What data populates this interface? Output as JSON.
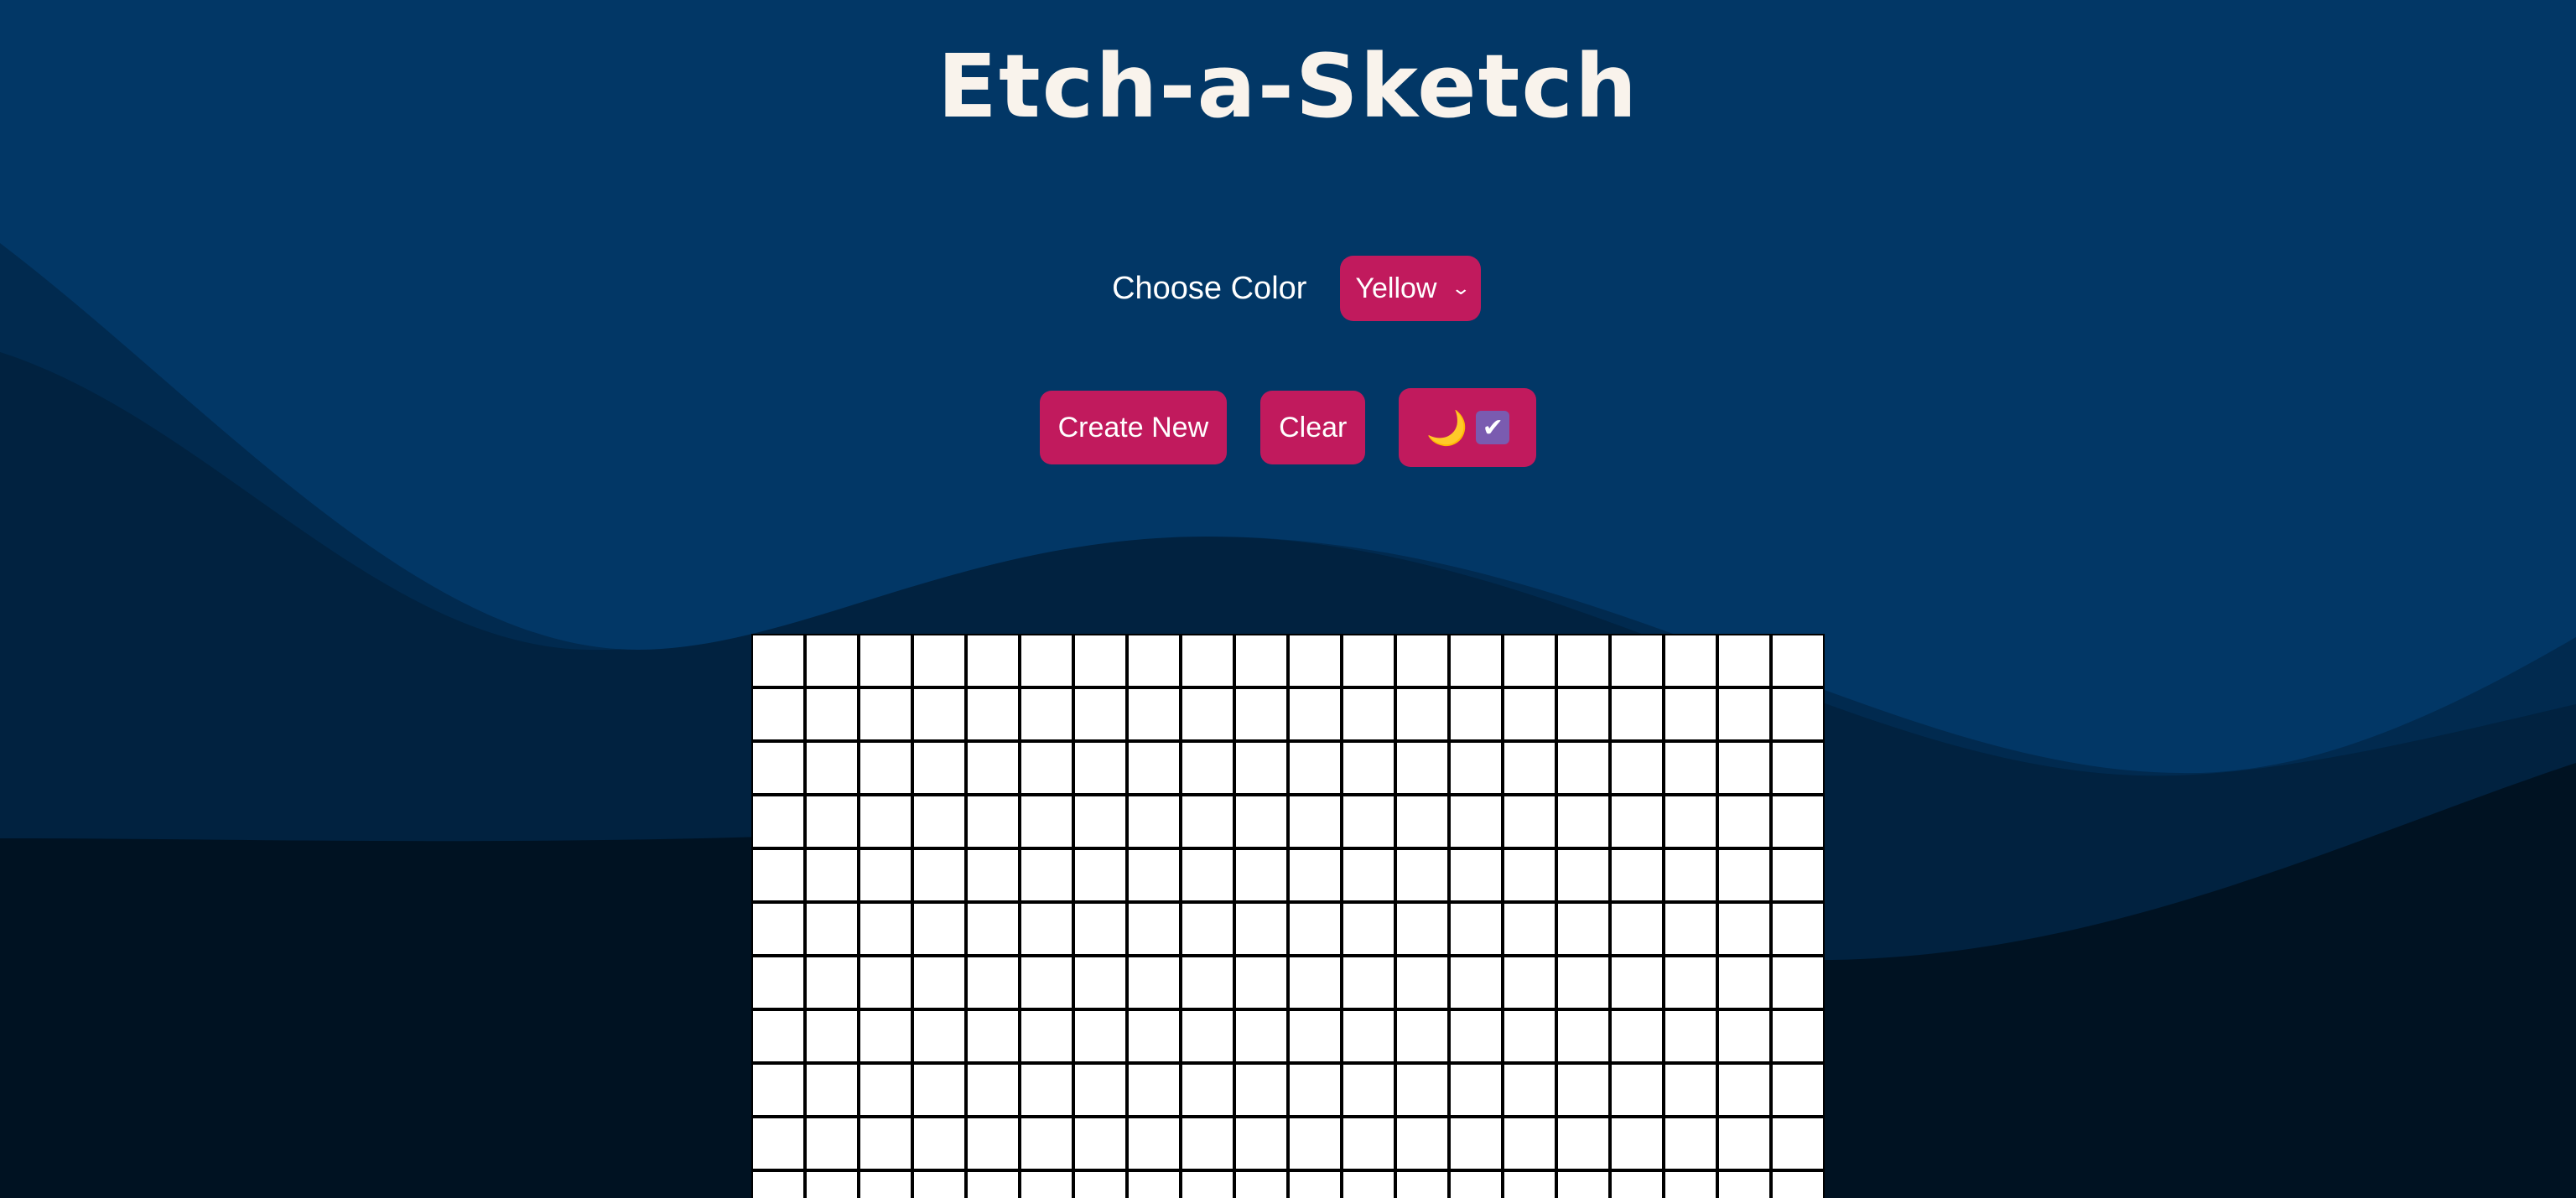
{
  "header": {
    "title": "Etch-a-Sketch"
  },
  "controls": {
    "color_label": "Choose Color",
    "color_select": {
      "selected": "Yellow"
    },
    "create_new_label": "Create New",
    "clear_label": "Clear",
    "dark_mode_toggle": {
      "icon": "moon-icon",
      "checked": true
    }
  },
  "grid": {
    "columns": 20,
    "visible_rows": 11
  },
  "colors": {
    "accent": "#c11a5d",
    "background_top": "#003366",
    "background_bottom": "#001222",
    "title": "#f9f3ec",
    "checkbox": "#7a5bb0"
  }
}
